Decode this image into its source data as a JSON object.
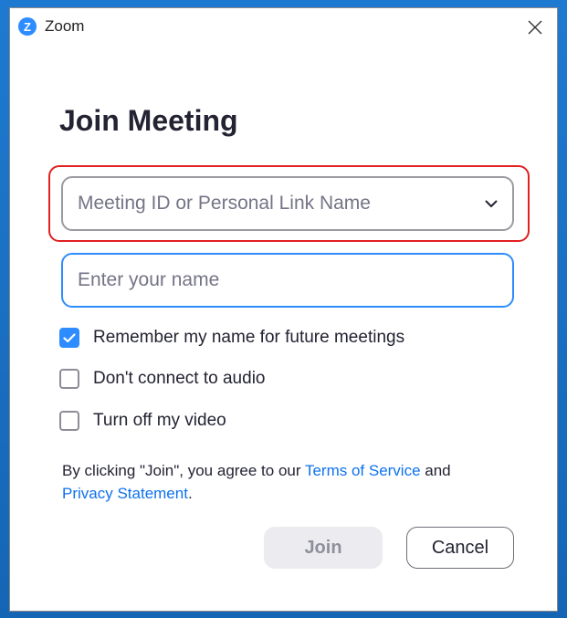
{
  "window": {
    "app_name": "Zoom",
    "logo_letter": "Z",
    "close_icon": "close-icon"
  },
  "dialog": {
    "heading": "Join Meeting",
    "meeting_id": {
      "value": "",
      "placeholder": "Meeting ID or Personal Link Name",
      "dropdown_icon": "chevron-down-icon",
      "highlighted": true
    },
    "name": {
      "value": "",
      "placeholder": "Enter your name",
      "focused": true
    },
    "options": [
      {
        "label": "Remember my name for future meetings",
        "checked": true
      },
      {
        "label": "Don't connect to audio",
        "checked": false
      },
      {
        "label": "Turn off my video",
        "checked": false
      }
    ],
    "terms": {
      "prefix": "By clicking \"Join\", you agree to our ",
      "tos_link": "Terms of Service",
      "middle": " and",
      "privacy_link": "Privacy Statement",
      "suffix": "."
    },
    "buttons": {
      "join": {
        "label": "Join",
        "enabled": false
      },
      "cancel": {
        "label": "Cancel"
      }
    }
  },
  "colors": {
    "accent": "#2d8cff",
    "link": "#0e72ed",
    "highlight": "#e02020",
    "text": "#232333",
    "desktop": "#1a6fbf"
  }
}
